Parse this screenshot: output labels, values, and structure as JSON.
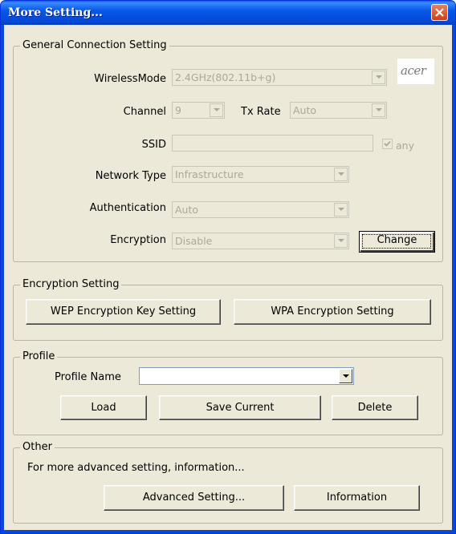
{
  "window": {
    "title": "More Setting..."
  },
  "general": {
    "group_title": "General Connection Setting",
    "wireless_mode_label": "WirelessMode",
    "wireless_mode_value": "2.4GHz(802.11b+g)",
    "logo_text": "acer",
    "channel_label": "Channel",
    "channel_value": "9",
    "tx_rate_label": "Tx Rate",
    "tx_rate_value": "Auto",
    "ssid_label": "SSID",
    "ssid_value": "",
    "any_label": "any",
    "any_checked": true,
    "network_type_label": "Network Type",
    "network_type_value": "Infrastructure",
    "authentication_label": "Authentication",
    "authentication_value": "Auto",
    "encryption_label": "Encryption",
    "encryption_value": "Disable",
    "change_button": "Change"
  },
  "encryption": {
    "group_title": "Encryption Setting",
    "wep_button": "WEP Encryption Key Setting",
    "wpa_button": "WPA Encryption Setting"
  },
  "profile": {
    "group_title": "Profile",
    "name_label": "Profile Name",
    "name_value": "",
    "load_button": "Load",
    "save_button": "Save Current",
    "delete_button": "Delete"
  },
  "other": {
    "group_title": "Other",
    "description": "For more advanced setting, information...",
    "advanced_button": "Advanced Setting...",
    "information_button": "Information"
  },
  "colors": {
    "title_bar": "#0858e8",
    "dialog_bg": "#ece9d8",
    "disabled_text": "#aca899",
    "close_button": "#d45a2e"
  }
}
